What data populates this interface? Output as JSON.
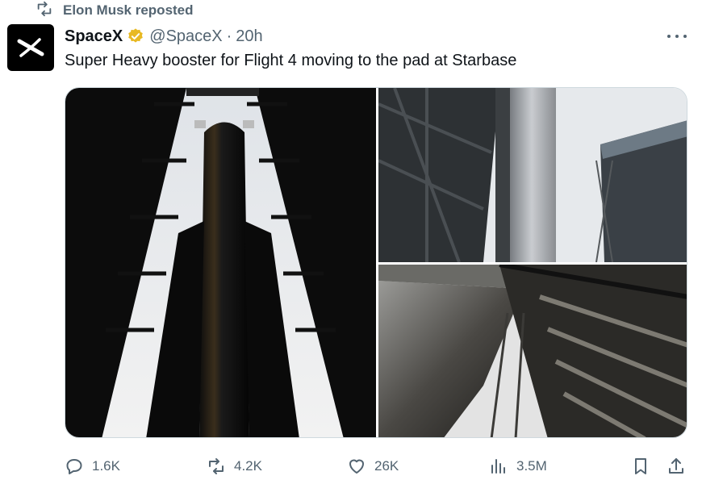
{
  "repost_banner": {
    "text": "Elon Musk reposted",
    "icon": "repost-icon"
  },
  "author": {
    "name": "SpaceX",
    "handle": "@SpaceX",
    "separator": "·",
    "time": "20h",
    "verified": true,
    "verified_color": "#f4c430",
    "avatar_icon": "spacex-x-logo"
  },
  "tweet": {
    "text": "Super Heavy booster for Flight 4 moving to the pad at Starbase"
  },
  "media": {
    "count": 3,
    "photos": [
      {
        "name": "booster-between-tower-beams",
        "layout": "left-full"
      },
      {
        "name": "booster-beside-building",
        "layout": "top-right"
      },
      {
        "name": "boosters-from-below",
        "layout": "bottom-right"
      }
    ]
  },
  "actions": {
    "replies": "1.6K",
    "reposts": "4.2K",
    "likes": "26K",
    "views": "3.5M",
    "icons": [
      "reply-icon",
      "repost-icon",
      "like-icon",
      "views-icon",
      "bookmark-icon",
      "share-icon"
    ]
  },
  "colors": {
    "text": "#0f1419",
    "secondary": "#536471",
    "border": "#cfd9de",
    "avatar_bg": "#000000"
  }
}
